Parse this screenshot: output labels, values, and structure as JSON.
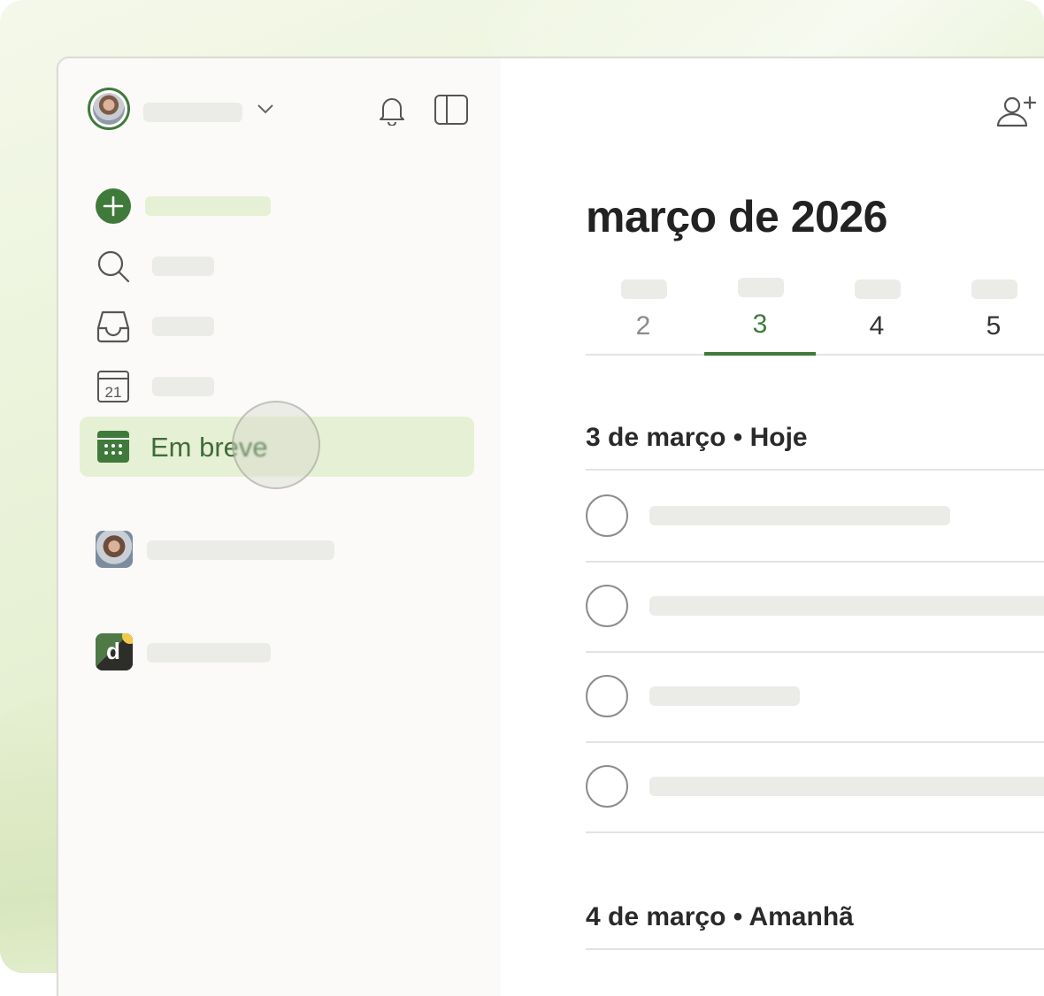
{
  "sidebar": {
    "nav": [
      {
        "key": "add-task",
        "icon": "plus-circle-icon"
      },
      {
        "key": "search",
        "icon": "search-icon"
      },
      {
        "key": "inbox",
        "icon": "inbox-icon"
      },
      {
        "key": "today",
        "icon": "calendar-day-icon",
        "icon_text": "21"
      },
      {
        "key": "upcoming",
        "icon": "calendar-grid-icon",
        "label": "Em breve",
        "active": true
      }
    ],
    "projects": [
      {
        "icon": "user-avatar"
      },
      {
        "icon": "team-logo",
        "logo_letter": "d"
      }
    ]
  },
  "main": {
    "title": "março de 2026",
    "days": [
      {
        "num": "2",
        "state": "past"
      },
      {
        "num": "3",
        "state": "selected"
      },
      {
        "num": "4",
        "state": "future"
      },
      {
        "num": "5",
        "state": "future"
      }
    ],
    "sections": [
      {
        "title": "3 de março • Hoje",
        "task_count": 4
      },
      {
        "title": "4 de março • Amanhã",
        "task_count": 0
      }
    ]
  },
  "colors": {
    "accent": "#3f7a3b",
    "active_bg": "#e6f0d4",
    "skeleton": "#ebebe8"
  }
}
